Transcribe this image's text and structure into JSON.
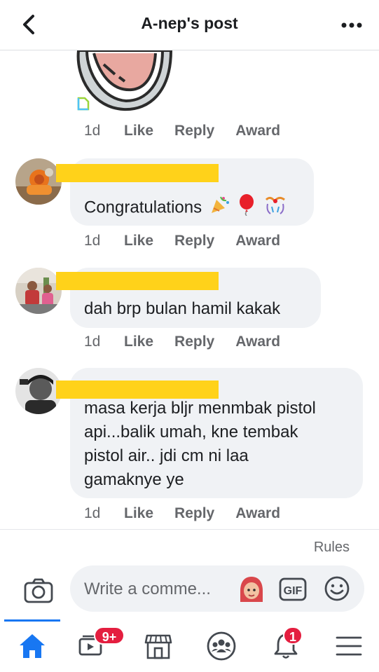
{
  "header": {
    "title": "A-nep's post",
    "back_icon": "chevron-left-icon",
    "more_icon": "more-horizontal-icon"
  },
  "top_comment": {
    "time": "1d",
    "like": "Like",
    "reply": "Reply",
    "award": "Award"
  },
  "comments": [
    {
      "text": "Congratulations",
      "time": "1d",
      "like": "Like",
      "reply": "Reply",
      "award": "Award"
    },
    {
      "text": "dah brp bulan hamil kakak",
      "time": "1d",
      "like": "Like",
      "reply": "Reply",
      "award": "Award"
    },
    {
      "text_lines": [
        "masa kerja bljr menmbak pistol",
        "api...balik umah, kne tembak",
        "pistol air.. jdi cm ni laa",
        "gamaknye ye"
      ],
      "time": "1d",
      "like": "Like",
      "reply": "Reply",
      "award": "Award"
    }
  ],
  "rules_label": "Rules",
  "compose": {
    "placeholder": "Write a comme...",
    "gif_label": "GIF"
  },
  "tabbar": {
    "watch_badge": "9+",
    "notifications_badge": "1"
  },
  "colors": {
    "accent": "#1877f2",
    "badge": "#e41e3f",
    "redaction": "#ffd21a",
    "bubble": "#f0f2f5"
  }
}
